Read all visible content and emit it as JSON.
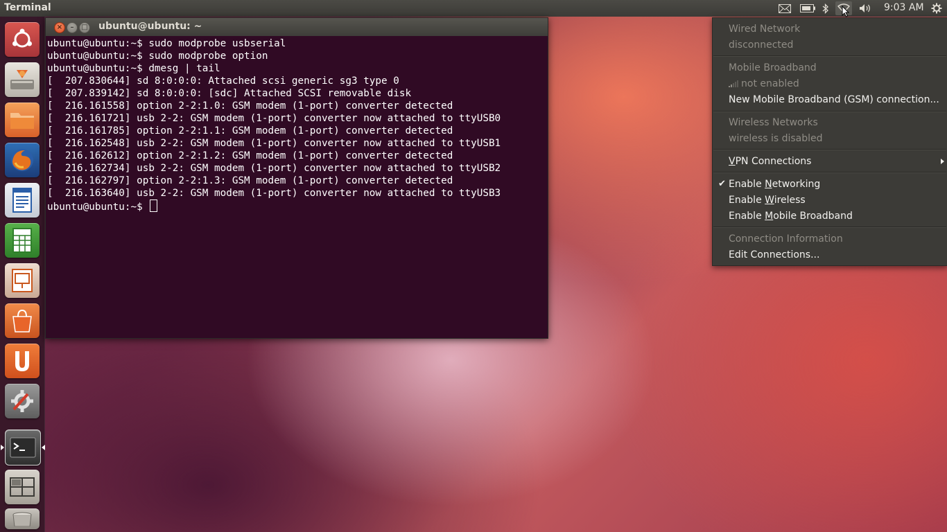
{
  "top_panel": {
    "title": "Terminal",
    "clock": "9:03 AM",
    "indicators": [
      "mail-icon",
      "battery-icon",
      "bluetooth-icon",
      "network-icon",
      "volume-icon",
      "session-gear-icon"
    ]
  },
  "launcher": {
    "items": [
      "dash-home",
      "ubuntu-one-installer",
      "files",
      "firefox",
      "libreoffice-writer",
      "libreoffice-calc",
      "libreoffice-impress",
      "ubuntu-software-center",
      "ubuntu-one",
      "system-settings",
      "terminal",
      "workspace-switcher",
      "trash"
    ],
    "active": "terminal"
  },
  "terminal": {
    "window_title": "ubuntu@ubuntu: ~",
    "close_glyph": "×",
    "min_glyph": "–",
    "max_glyph": "□",
    "lines": [
      "ubuntu@ubuntu:~$ sudo modprobe usbserial",
      "ubuntu@ubuntu:~$ sudo modprobe option",
      "ubuntu@ubuntu:~$ dmesg | tail",
      "[  207.830644] sd 8:0:0:0: Attached scsi generic sg3 type 0",
      "[  207.839142] sd 8:0:0:0: [sdc] Attached SCSI removable disk",
      "[  216.161558] option 2-2:1.0: GSM modem (1-port) converter detected",
      "[  216.161721] usb 2-2: GSM modem (1-port) converter now attached to ttyUSB0",
      "[  216.161785] option 2-2:1.1: GSM modem (1-port) converter detected",
      "[  216.162548] usb 2-2: GSM modem (1-port) converter now attached to ttyUSB1",
      "[  216.162612] option 2-2:1.2: GSM modem (1-port) converter detected",
      "[  216.162734] usb 2-2: GSM modem (1-port) converter now attached to ttyUSB2",
      "[  216.162797] option 2-2:1.3: GSM modem (1-port) converter detected",
      "[  216.163640] usb 2-2: GSM modem (1-port) converter now attached to ttyUSB3"
    ],
    "prompt": "ubuntu@ubuntu:~$ "
  },
  "network_menu": {
    "wired_header": "Wired Network",
    "wired_status": "disconnected",
    "mobile_header": "Mobile Broadband",
    "mobile_status": "not enabled",
    "new_mobile_connection": "New Mobile Broadband (GSM) connection...",
    "wireless_header": "Wireless Networks",
    "wireless_status": "wireless is disabled",
    "vpn": {
      "pre": "",
      "u": "V",
      "post": "PN Connections"
    },
    "enable_networking": {
      "pre": "Enable ",
      "u": "N",
      "post": "etworking"
    },
    "enable_wireless": {
      "pre": "Enable ",
      "u": "W",
      "post": "ireless"
    },
    "enable_mobile": {
      "pre": "Enable ",
      "u": "M",
      "post": "obile Broadband"
    },
    "check_glyph": "✔",
    "connection_info": "Connection Information",
    "edit_connections": "Edit Connections..."
  }
}
